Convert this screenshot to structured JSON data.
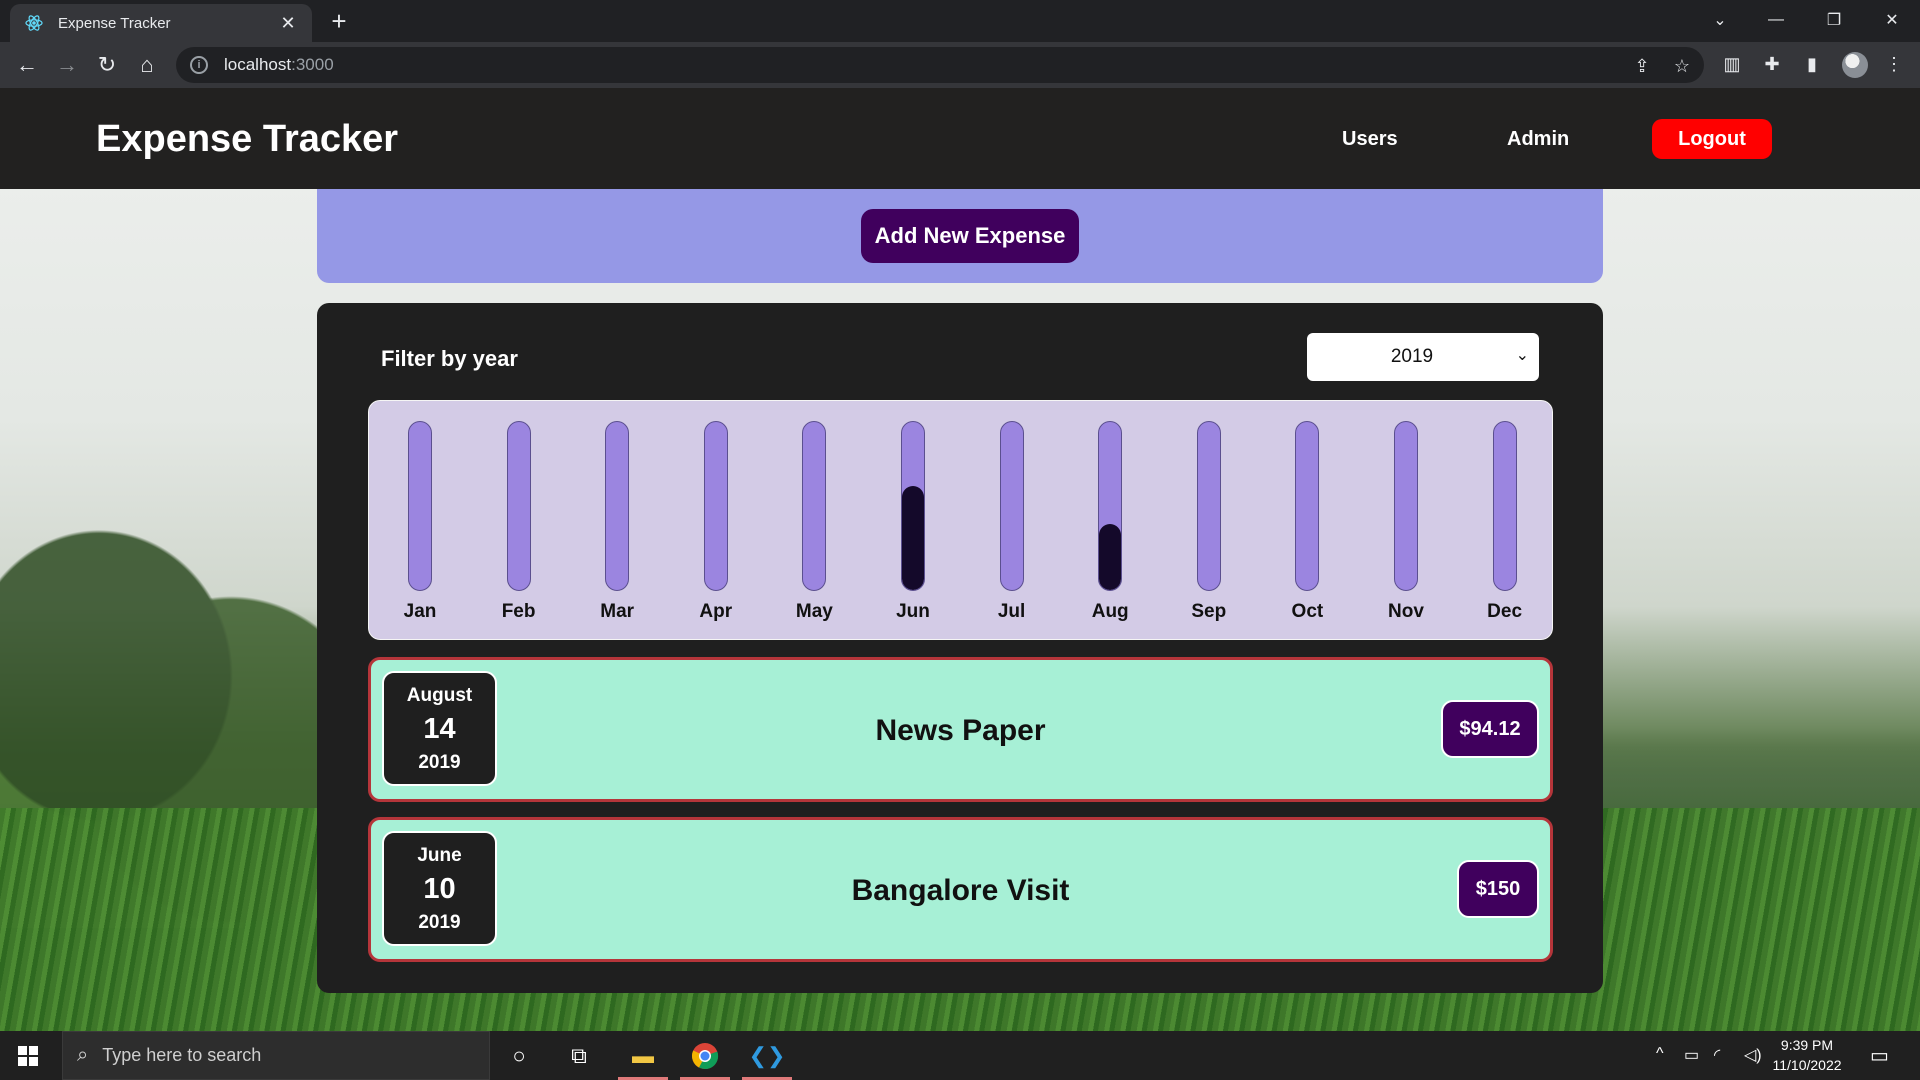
{
  "browser": {
    "tab_title": "Expense Tracker",
    "url_host": "localhost",
    "url_port": ":3000"
  },
  "header": {
    "brand": "Expense Tracker",
    "nav": [
      "Users",
      "Admin"
    ],
    "logout_label": "Logout"
  },
  "actions": {
    "add_label": "Add New Expense"
  },
  "filter": {
    "label": "Filter by year",
    "selected_year": "2019"
  },
  "chart_data": {
    "type": "bar",
    "categories": [
      "Jan",
      "Feb",
      "Mar",
      "Apr",
      "May",
      "Jun",
      "Jul",
      "Aug",
      "Sep",
      "Oct",
      "Nov",
      "Dec"
    ],
    "values": [
      0,
      0,
      0,
      0,
      0,
      150,
      0,
      94.12,
      0,
      0,
      0,
      0
    ],
    "ylim": [
      0,
      244.12
    ],
    "colors": {
      "track": "#9b85e0",
      "fill": "#14092a"
    }
  },
  "expenses": [
    {
      "month": "August",
      "day": "14",
      "year": "2019",
      "title": "News Paper",
      "amount": "$94.12"
    },
    {
      "month": "June",
      "day": "10",
      "year": "2019",
      "title": "Bangalore Visit",
      "amount": "$150"
    }
  ],
  "taskbar": {
    "search_placeholder": "Type here to search",
    "time": "9:39 PM",
    "date": "11/10/2022"
  },
  "colors": {
    "header_bg": "#222120",
    "logout": "#ff0000",
    "add_panel": "#9598e6",
    "primary_button": "#40005d",
    "item_bg": "#a7f0d6",
    "item_border": "#b5353a"
  }
}
